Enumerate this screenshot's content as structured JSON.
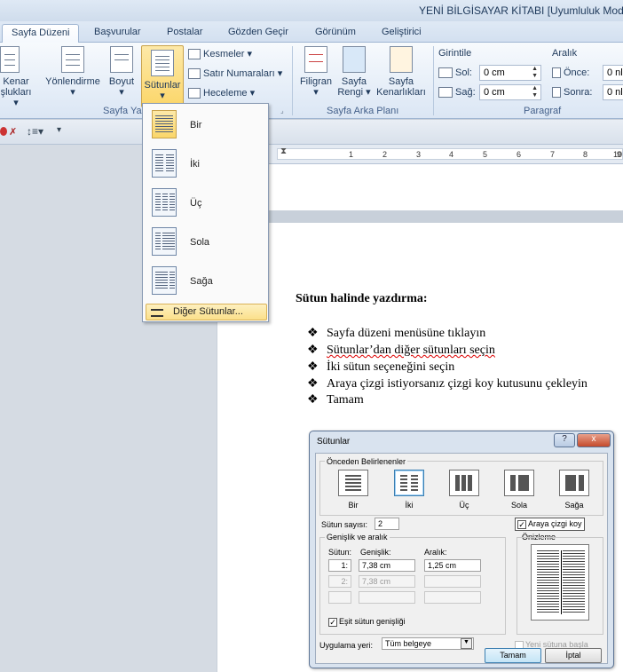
{
  "window": {
    "title": "YENİ BİLGİSAYAR KİTABI [Uyumluluk Modu"
  },
  "tabs": [
    "Sayfa Düzeni",
    "Başvurular",
    "Postalar",
    "Gözden Geçir",
    "Görünüm",
    "Geliştirici"
  ],
  "ribbon": {
    "margins_label1": "Kenar",
    "margins_label2": "şlukları",
    "orientation_label": "Yönlendirme",
    "size_label": "Boyut",
    "columns_label": "Sütunlar",
    "breaks_label": "Kesmeler",
    "line_numbers_label": "Satır Numaraları",
    "hyphenation_label": "Heceleme",
    "page_setup_group": "Sayfa Yap",
    "watermark_label": "Filigran",
    "page_color_label1": "Sayfa",
    "page_color_label2": "Rengi",
    "page_borders_label1": "Sayfa",
    "page_borders_label2": "Kenarlıkları",
    "page_background_group": "Sayfa Arka Planı",
    "indent_title": "Girintile",
    "indent_left_label": "Sol:",
    "indent_left_value": "0 cm",
    "indent_right_label": "Sağ:",
    "indent_right_value": "0 cm",
    "spacing_title": "Aralık",
    "spacing_before_label": "Önce:",
    "spacing_before_value": "0 nl",
    "spacing_after_label": "Sonra:",
    "spacing_after_value": "0 nl",
    "paragraph_group": "Paragraf"
  },
  "ruler": {
    "numbers": [
      "1",
      "2",
      "3",
      "4",
      "5",
      "6",
      "7",
      "8",
      "9",
      "10"
    ]
  },
  "columns_menu": {
    "items": [
      "Bir",
      "İki",
      "Üç",
      "Sola",
      "Sağa"
    ],
    "more": "Diğer Sütunlar..."
  },
  "document": {
    "heading": "Sütun halinde yazdırma:",
    "bullets": [
      "Sayfa düzeni menüsüne tıklayın",
      "Sütunlar’dan diğer sütunları seçin",
      "İki sütun seçeneğini  seçin",
      "Araya çizgi istiyorsanız çizgi koy kutusunu çekleyin",
      "Tamam"
    ],
    "bullet_glyph": "❖"
  },
  "dialog": {
    "title": "Sütunlar",
    "help_button": "?",
    "close_button": "x",
    "presets_title": "Önceden Belirlenenler",
    "presets": [
      "Bir",
      "İki",
      "Üç",
      "Sola",
      "Sağa"
    ],
    "count_label": "Sütun sayısı:",
    "count_value": "2",
    "line_between_label": "Araya çizgi koy",
    "width_spacing_title": "Genişlik ve aralık",
    "col_header": "Sütun:",
    "width_header": "Genişlik:",
    "spacing_header": "Aralık:",
    "rows": [
      {
        "num": "1:",
        "width": "7,38 cm",
        "spacing": "1,25 cm"
      },
      {
        "num": "2:",
        "width": "7,38 cm",
        "spacing": ""
      },
      {
        "num": "",
        "width": "",
        "spacing": ""
      }
    ],
    "preview_title": "Önizleme",
    "equal_width_label": "Eşit sütun genişliği",
    "apply_to_label": "Uygulama yeri:",
    "apply_to_value": "Tüm belgeye",
    "new_column_label": "Yeni sütuna başla",
    "ok_button": "Tamam",
    "cancel_button": "İptal"
  }
}
